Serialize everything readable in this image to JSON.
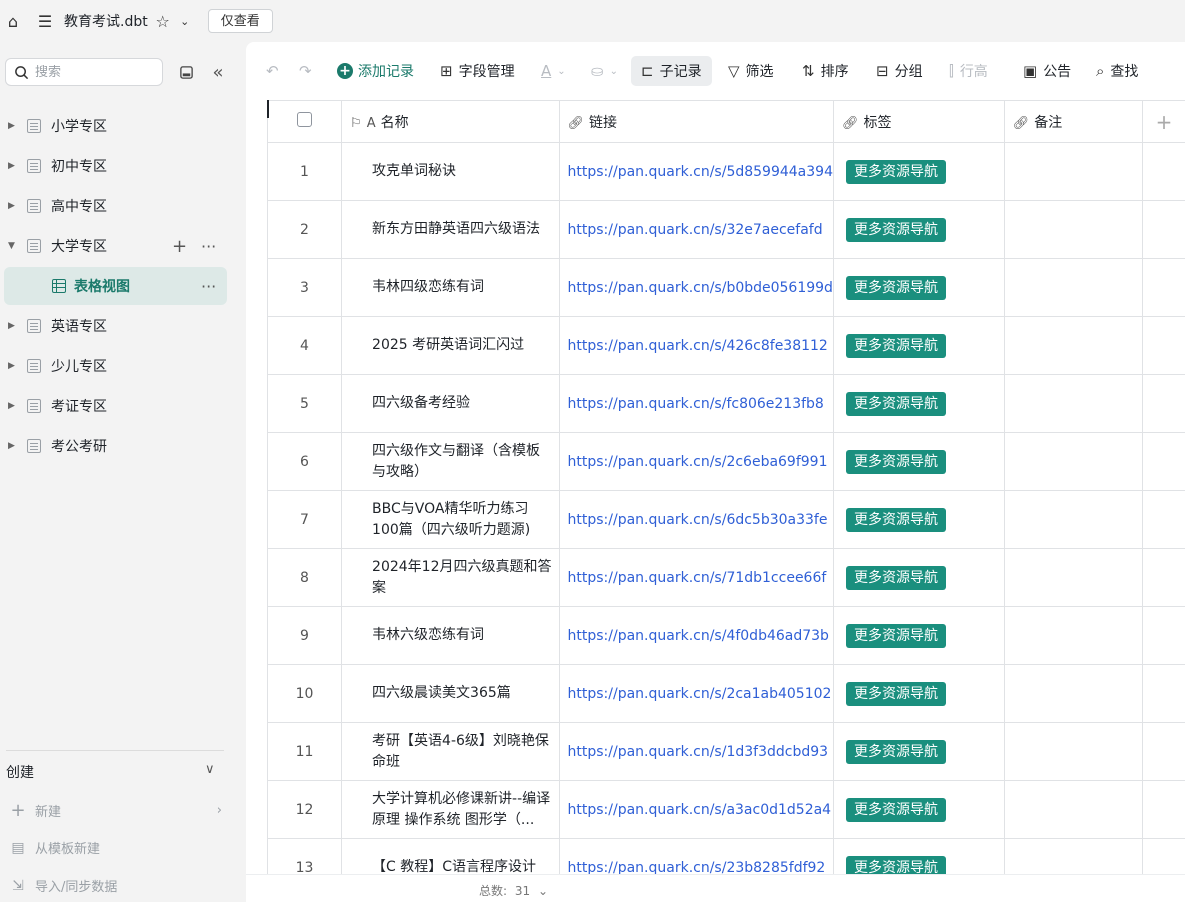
{
  "app": {
    "title": "教育考试.dbt",
    "readonly_label": "仅查看"
  },
  "sidebar": {
    "search_placeholder": "搜索",
    "items": [
      {
        "label": "小学专区"
      },
      {
        "label": "初中专区"
      },
      {
        "label": "高中专区"
      },
      {
        "label": "大学专区"
      },
      {
        "label": "表格视图"
      },
      {
        "label": "英语专区"
      },
      {
        "label": "少儿专区"
      },
      {
        "label": "考证专区"
      },
      {
        "label": "考公考研"
      }
    ],
    "create": {
      "heading": "创建",
      "new_label": "新建",
      "from_template_label": "从模板新建",
      "import_label": "导入/同步数据"
    }
  },
  "toolbar": {
    "add_record": "添加记录",
    "field_manage": "字段管理",
    "sub_record": "子记录",
    "filter": "筛选",
    "sort": "排序",
    "group": "分组",
    "row_height": "行高",
    "notice": "公告",
    "find": "查找"
  },
  "table": {
    "columns": [
      "名称",
      "链接",
      "标签",
      "备注"
    ],
    "rows": [
      {
        "num": "1",
        "name": "攻克单词秘诀",
        "link": "https://pan.quark.cn/s/5d859944a394",
        "tag": "更多资源导航"
      },
      {
        "num": "2",
        "name": "新东方田静英语四六级语法",
        "link": "https://pan.quark.cn/s/32e7aecefafd",
        "tag": "更多资源导航"
      },
      {
        "num": "3",
        "name": "韦林四级恋练有词",
        "link": "https://pan.quark.cn/s/b0bde056199d",
        "tag": "更多资源导航"
      },
      {
        "num": "4",
        "name": "2025 考研英语词汇闪过",
        "link": "https://pan.quark.cn/s/426c8fe38112",
        "tag": "更多资源导航"
      },
      {
        "num": "5",
        "name": "四六级备考经验",
        "link": "https://pan.quark.cn/s/fc806e213fb8",
        "tag": "更多资源导航"
      },
      {
        "num": "6",
        "name": "四六级作文与翻译（含模板与攻略）",
        "link": "https://pan.quark.cn/s/2c6eba69f991",
        "tag": "更多资源导航"
      },
      {
        "num": "7",
        "name": "BBC与VOA精华听力练习100篇（四六级听力题源)",
        "link": "https://pan.quark.cn/s/6dc5b30a33fe",
        "tag": "更多资源导航"
      },
      {
        "num": "8",
        "name": "2024年12月四六级真题和答案",
        "link": "https://pan.quark.cn/s/71db1ccee66f",
        "tag": "更多资源导航"
      },
      {
        "num": "9",
        "name": "韦林六级恋练有词",
        "link": "https://pan.quark.cn/s/4f0db46ad73b",
        "tag": "更多资源导航"
      },
      {
        "num": "10",
        "name": "四六级晨读美文365篇",
        "link": "https://pan.quark.cn/s/2ca1ab405102",
        "tag": "更多资源导航"
      },
      {
        "num": "11",
        "name": "考研【英语4-6级】刘晓艳保命班",
        "link": "https://pan.quark.cn/s/1d3f3ddcbd93",
        "tag": "更多资源导航"
      },
      {
        "num": "12",
        "name": "大学计算机必修课新讲--编译原理 操作系统 图形学（...",
        "link": "https://pan.quark.cn/s/a3ac0d1d52a4",
        "tag": "更多资源导航"
      },
      {
        "num": "13",
        "name": "【C 教程】C语言程序设计",
        "link": "https://pan.quark.cn/s/23b8285fdf92",
        "tag": "更多资源导航"
      }
    ]
  },
  "footer": {
    "total_label": "总数:",
    "total_count": "31"
  },
  "colors": {
    "accent": "#1b7a6b",
    "tag_bg": "#1a8f7e",
    "link": "#2f5fd6"
  }
}
